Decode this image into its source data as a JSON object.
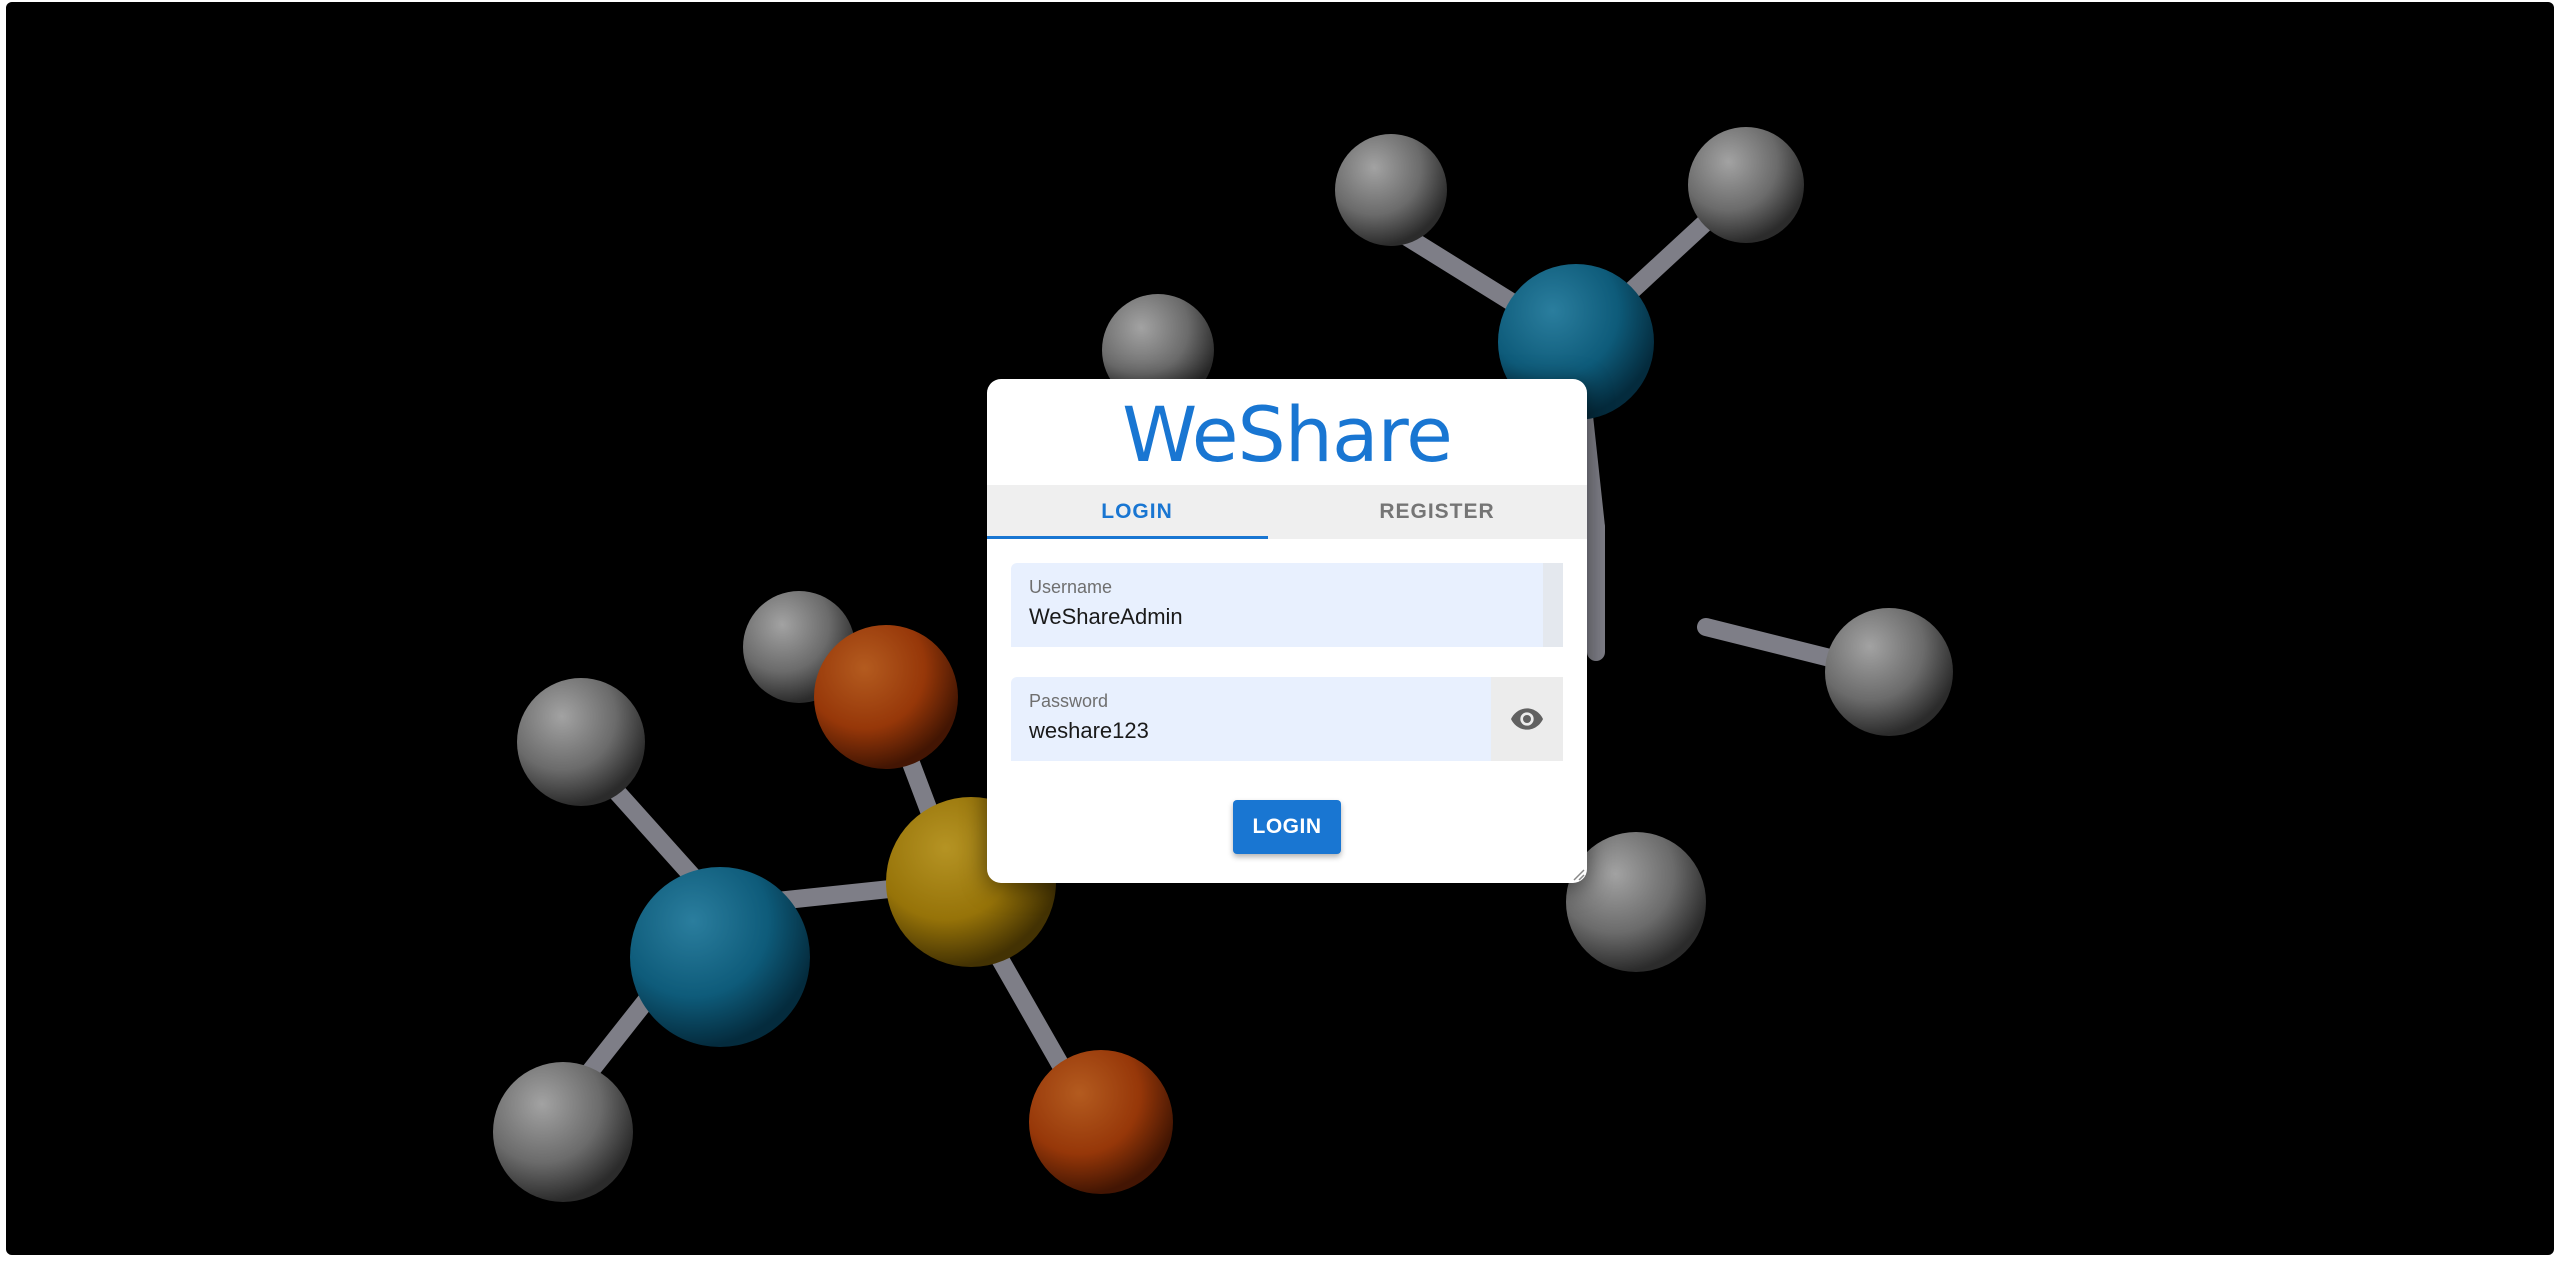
{
  "app": {
    "brand": "WeShare"
  },
  "tabs": [
    {
      "label": "LOGIN",
      "active": true
    },
    {
      "label": "REGISTER",
      "active": false
    }
  ],
  "form": {
    "username": {
      "label": "Username",
      "value": "WeShareAdmin"
    },
    "password": {
      "label": "Password",
      "value": "weshare123",
      "toggle_icon": "eye-icon"
    },
    "submit_label": "LOGIN"
  },
  "colors": {
    "accent": "#1976d2",
    "field_bg": "#e8f0fe",
    "background": "#000000"
  }
}
